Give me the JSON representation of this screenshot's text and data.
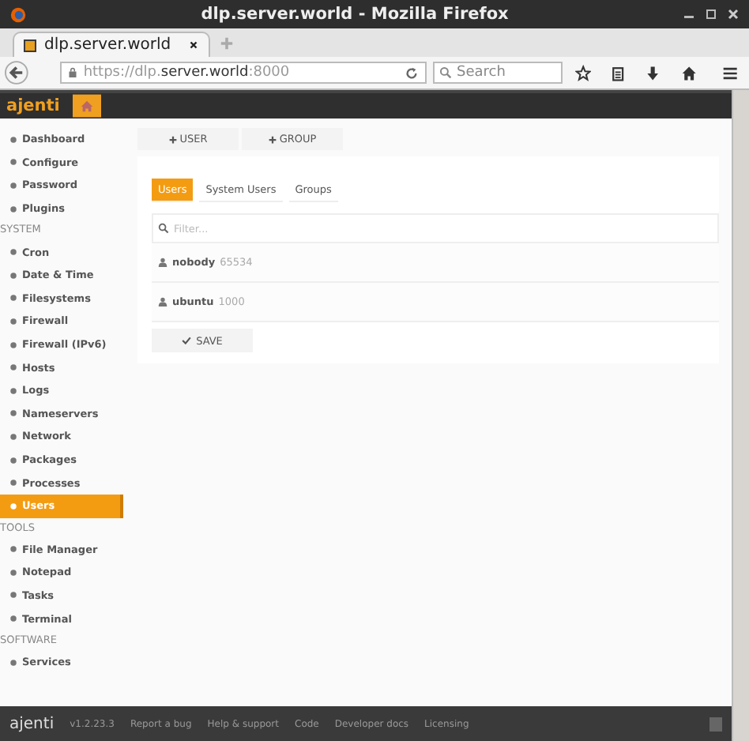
{
  "window": {
    "title": "dlp.server.world - Mozilla Firefox"
  },
  "browser": {
    "tabs": [
      {
        "label": "dlp.server.world",
        "selected": true
      }
    ],
    "url_prefix": "https://dlp.",
    "url_host": "server.world",
    "url_suffix": ":8000",
    "search_placeholder": "Search"
  },
  "app": {
    "brand": "ajenti"
  },
  "sidebar": {
    "sections": [
      {
        "items": [
          {
            "label": "Dashboard",
            "selected": false
          },
          {
            "label": "Configure",
            "selected": false
          },
          {
            "label": "Password",
            "selected": false
          },
          {
            "label": "Plugins",
            "selected": false
          }
        ]
      },
      {
        "heading": "SYSTEM",
        "items": [
          {
            "label": "Cron",
            "selected": false
          },
          {
            "label": "Date & Time",
            "selected": false
          },
          {
            "label": "Filesystems",
            "selected": false
          },
          {
            "label": "Firewall",
            "selected": false
          },
          {
            "label": "Firewall (IPv6)",
            "selected": false
          },
          {
            "label": "Hosts",
            "selected": false
          },
          {
            "label": "Logs",
            "selected": false
          },
          {
            "label": "Nameservers",
            "selected": false
          },
          {
            "label": "Network",
            "selected": false
          },
          {
            "label": "Packages",
            "selected": false
          },
          {
            "label": "Processes",
            "selected": false
          },
          {
            "label": "Users",
            "selected": true
          }
        ]
      },
      {
        "heading": "TOOLS",
        "items": [
          {
            "label": "File Manager",
            "selected": false
          },
          {
            "label": "Notepad",
            "selected": false
          },
          {
            "label": "Tasks",
            "selected": false
          },
          {
            "label": "Terminal",
            "selected": false
          }
        ]
      },
      {
        "heading": "SOFTWARE",
        "items": [
          {
            "label": "Services",
            "selected": false
          }
        ]
      }
    ]
  },
  "toolbar": {
    "buttons": [
      "USER",
      "GROUP"
    ]
  },
  "tabs": [
    {
      "label": "Users",
      "selected": true
    },
    {
      "label": "System Users",
      "selected": false
    },
    {
      "label": "Groups",
      "selected": false
    }
  ],
  "filter": {
    "placeholder": "Filter..."
  },
  "users": [
    {
      "name": "nobody",
      "uid": "65534"
    },
    {
      "name": "ubuntu",
      "uid": "1000"
    }
  ],
  "save_button": "SAVE",
  "footer": {
    "brand": "ajenti",
    "version": "v1.2.23.3",
    "links": [
      "Report a bug",
      "Help & support",
      "Code",
      "Developer docs",
      "Licensing"
    ]
  }
}
